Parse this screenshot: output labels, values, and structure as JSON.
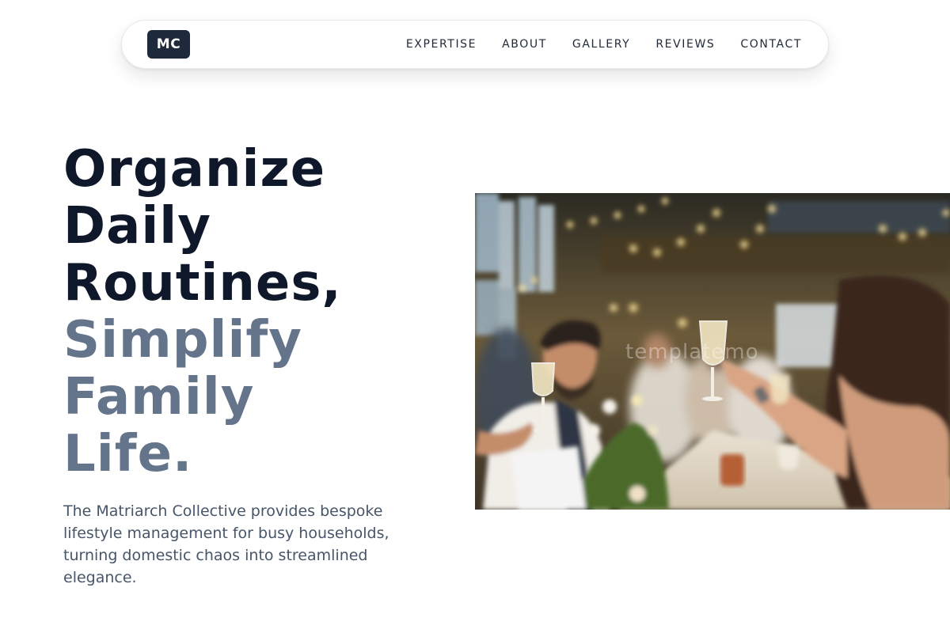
{
  "nav": {
    "logo": "MC",
    "links": [
      "EXPERTISE",
      "ABOUT",
      "GALLERY",
      "REVIEWS",
      "CONTACT"
    ]
  },
  "hero": {
    "title_dark": [
      "Organize",
      "Daily",
      "Routines,"
    ],
    "title_muted": [
      "Simplify",
      "Family",
      "Life."
    ],
    "description": "The Matriarch Collective provides bespoke lifestyle management for busy households, turning domestic chaos into streamlined elegance.",
    "image": {
      "subject": "banquet-toast-photo",
      "watermark": "templatemo"
    }
  },
  "colors": {
    "primary_text": "#0f172a",
    "muted_text": "#64748b",
    "body_text": "#475569",
    "logo_bg": "#1e293b"
  }
}
